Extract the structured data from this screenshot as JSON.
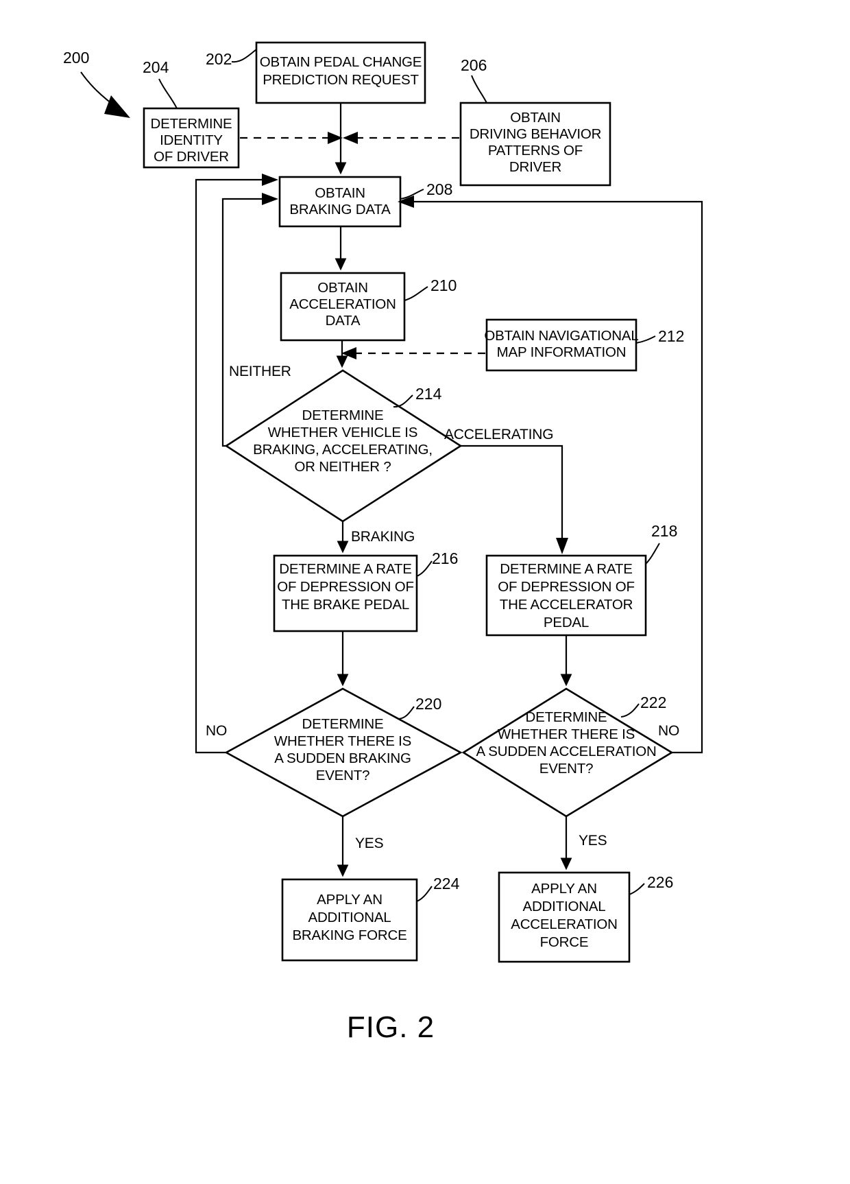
{
  "figure": {
    "caption": "FIG. 2",
    "diagram_ref": "200"
  },
  "nodes": [
    {
      "id": "202",
      "ref": "202",
      "shape": "process",
      "lines": [
        "OBTAIN PEDAL CHANGE",
        "PREDICTION REQUEST"
      ]
    },
    {
      "id": "204",
      "ref": "204",
      "shape": "process",
      "lines": [
        "DETERMINE",
        "IDENTITY",
        "OF DRIVER"
      ]
    },
    {
      "id": "206",
      "ref": "206",
      "shape": "process",
      "lines": [
        "OBTAIN",
        "DRIVING BEHAVIOR",
        "PATTERNS OF",
        "DRIVER"
      ]
    },
    {
      "id": "208",
      "ref": "208",
      "shape": "process",
      "lines": [
        "OBTAIN",
        "BRAKING DATA"
      ]
    },
    {
      "id": "210",
      "ref": "210",
      "shape": "process",
      "lines": [
        "OBTAIN",
        "ACCELERATION",
        "DATA"
      ]
    },
    {
      "id": "212",
      "ref": "212",
      "shape": "process",
      "lines": [
        "OBTAIN NAVIGATIONAL",
        "MAP INFORMATION"
      ]
    },
    {
      "id": "214",
      "ref": "214",
      "shape": "decision",
      "lines": [
        "DETERMINE",
        "WHETHER VEHICLE IS",
        "BRAKING, ACCELERATING,",
        "OR NEITHER ?"
      ]
    },
    {
      "id": "216",
      "ref": "216",
      "shape": "process",
      "lines": [
        "DETERMINE A RATE",
        "OF DEPRESSION OF",
        "THE BRAKE PEDAL"
      ]
    },
    {
      "id": "218",
      "ref": "218",
      "shape": "process",
      "lines": [
        "DETERMINE A RATE",
        "OF DEPRESSION OF",
        "THE ACCELERATOR",
        "PEDAL"
      ]
    },
    {
      "id": "220",
      "ref": "220",
      "shape": "decision",
      "lines": [
        "DETERMINE",
        "WHETHER THERE IS",
        "A SUDDEN BRAKING",
        "EVENT?"
      ]
    },
    {
      "id": "222",
      "ref": "222",
      "shape": "decision",
      "lines": [
        "DETERMINE",
        "WHETHER THERE IS",
        "A SUDDEN ACCELERATION",
        "EVENT?"
      ]
    },
    {
      "id": "224",
      "ref": "224",
      "shape": "process",
      "lines": [
        "APPLY AN",
        "ADDITIONAL",
        "BRAKING FORCE"
      ]
    },
    {
      "id": "226",
      "ref": "226",
      "shape": "process",
      "lines": [
        "APPLY AN",
        "ADDITIONAL",
        "ACCELERATION",
        "FORCE"
      ]
    }
  ],
  "edge_labels": {
    "neither": "NEITHER",
    "accelerating": "ACCELERATING",
    "braking": "BRAKING",
    "no_left": "NO",
    "no_right": "NO",
    "yes_left": "YES",
    "yes_right": "YES"
  },
  "colors": {
    "stroke": "#000000",
    "fill": "#ffffff",
    "background": "#ffffff"
  }
}
